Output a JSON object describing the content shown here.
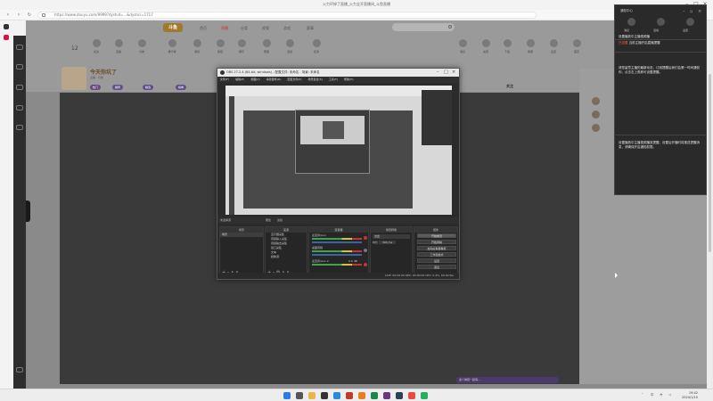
{
  "browser": {
    "tab_title": "火力坏掉了直播_火力全开直播间_斗鱼直播",
    "url": "https://www.douyu.com/9999?dyshid=...&dyshci=1717"
  },
  "site": {
    "logo_text": "斗鱼",
    "nav": [
      "首页",
      "直播",
      "分类",
      "视频",
      "游戏",
      "赛事"
    ],
    "category_counter": "12",
    "categories": [
      "关注",
      "直播",
      "分类",
      "排行榜",
      "游戏",
      "鱼吧",
      "娱乐",
      "赛事",
      "活动",
      "任务",
      "消息",
      "充值",
      "下载",
      "客服",
      "设置",
      "首页"
    ]
  },
  "streamer": {
    "name": "今天你坑了",
    "meta": "主播 · 分类",
    "tags": [
      "热门",
      "推荐",
      "精选",
      "榜单"
    ],
    "follow_label": "关注"
  },
  "chat": {
    "danmu_hint": "发个弹幕一起嗨..."
  },
  "obs": {
    "title": "OBS 27.2.4 (64-bit, windows) - 配置文件: 未命名 - 场景: 未命名",
    "menu": [
      "文件(F)",
      "编辑(E)",
      "视图(V)",
      "停靠部件(D)",
      "配置文件(P)",
      "场景集合(S)",
      "工具(T)",
      "帮助(H)"
    ],
    "toolbar_left": "未选择源",
    "toolbar_mid": "属性",
    "toolbar_filter": "滤镜",
    "docks": {
      "scenes": "场景",
      "sources": "来源",
      "mixer": "混音器",
      "transitions": "场景转场",
      "controls": "控件"
    },
    "scene_item": "场景",
    "sources": [
      "显示器采集",
      "音频输入采集",
      "音频输出采集",
      "窗口采集",
      "文本",
      "媒体源"
    ],
    "mixer": [
      {
        "name": "麦克风/Aux",
        "db": "0.0 dB"
      },
      {
        "name": "桌面音频",
        "db": "0.0 dB"
      },
      {
        "name": "麦克风/Aux 2",
        "db": "0.0 dB"
      }
    ],
    "transition": {
      "type": "淡出",
      "duration_label": "时长",
      "duration": "300 ms"
    },
    "controls": [
      "开始推流",
      "开始录制",
      "启动虚拟摄像机",
      "工作室模式",
      "设置",
      "退出"
    ],
    "status": "LIVE: 00:00:00   REC: 00:00:00   CPU: 0.4%, 60.00 fps"
  },
  "notification": {
    "header": "通知中心",
    "tabs": [
      "消息",
      "活动",
      "设置"
    ],
    "line1": "设置播放中主播视频播",
    "line2_red": "已设置",
    "line2": "当前主播开启直播提醒",
    "para1": "请您留意主播的最新动态，订阅提醒后我们会第一时间通知你，点击右上角即可设置提醒。",
    "para2": "设置播放中主播视频播放提醒，设置后开播时将推送提醒消息，请确保开启通知权限。"
  },
  "taskbar": {
    "tray_lang": "中",
    "time": "19:42",
    "date": "2024/1/10"
  }
}
